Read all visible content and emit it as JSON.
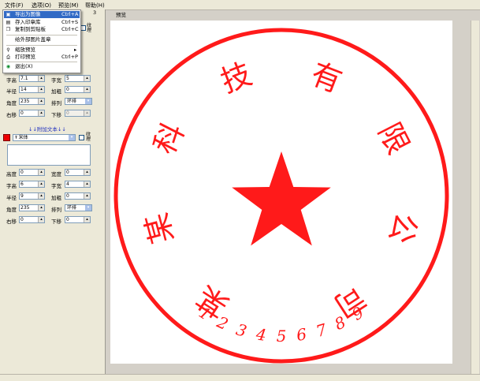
{
  "menubar": {
    "items": [
      {
        "label": "文件(F)"
      },
      {
        "label": "选项(O)"
      },
      {
        "label": "预览(M)"
      },
      {
        "label": "帮助(H)"
      }
    ]
  },
  "file_menu": {
    "items": [
      {
        "label": "导出为图像",
        "shortcut": "Ctrl+A",
        "icon": "export-icon",
        "selected": true
      },
      {
        "label": "存入印章库",
        "shortcut": "Ctrl+S",
        "icon": "save-icon"
      },
      {
        "label": "复制到剪贴板",
        "shortcut": "Ctrl+C",
        "icon": "copy-icon"
      },
      {
        "label": "给外部图片盖章",
        "shortcut": "",
        "icon": ""
      },
      {
        "label": "缩放预览",
        "shortcut": "",
        "icon": "zoom-icon",
        "submenu": true
      },
      {
        "label": "打印预览",
        "shortcut": "Ctrl+P",
        "icon": "print-icon"
      },
      {
        "label": "退出(X)",
        "shortcut": "",
        "icon": "exit-icon"
      }
    ],
    "submenu_arrow": "▸"
  },
  "left_panel": {
    "tab_fragment": "3",
    "texture_label": "纹理",
    "upper": {
      "font_height_label": "字高",
      "font_height_value": "7.1",
      "font_width_label": "字宽",
      "font_width_value": "5",
      "radius_label": "半径",
      "radius_value": "14",
      "bold_label": "加粗",
      "bold_value": "0",
      "angle_label": "角度",
      "angle_value": "235",
      "arrange_label": "排列",
      "arrange_value": "环排",
      "right_label": "右移",
      "right_value": "0",
      "down_label": "下移",
      "down_value": "0"
    },
    "extra_text_header": "↓↓附加文本↓↓",
    "font_name": "宋体",
    "lower": {
      "height_label": "高度",
      "height_value": "0",
      "width_label": "宽度",
      "width_value": "0",
      "font_height_label": "字高",
      "font_height_value": "6",
      "font_width_label": "字宽",
      "font_width_value": "4",
      "radius_label": "半径",
      "radius_value": "9",
      "bold_label": "加粗",
      "bold_value": "0",
      "angle_label": "角度",
      "angle_value": "235",
      "arrange_label": "排列",
      "arrange_value": "环排",
      "right_label": "右移",
      "right_value": "0",
      "down_label": "下移",
      "down_value": "0"
    },
    "color_swatch": "#ee0000"
  },
  "preview": {
    "label": "预览",
    "seal": {
      "color": "#ff1a1a",
      "main_text": [
        "某",
        "某",
        "科",
        "技",
        "有",
        "限",
        "公",
        "司"
      ],
      "bottom_text": [
        "1",
        "2",
        "3",
        "4",
        "5",
        "6",
        "7",
        "8",
        "9"
      ]
    }
  }
}
